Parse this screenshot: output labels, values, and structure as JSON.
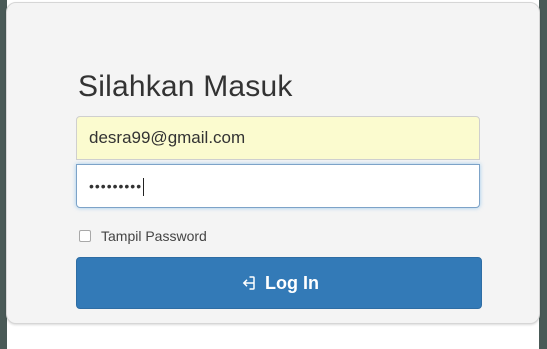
{
  "title": "Silahkan Masuk",
  "email_value": "desra99@gmail.com",
  "password_value": "•••••••••",
  "show_password_label": "Tampil Password",
  "login_label": "Log In"
}
